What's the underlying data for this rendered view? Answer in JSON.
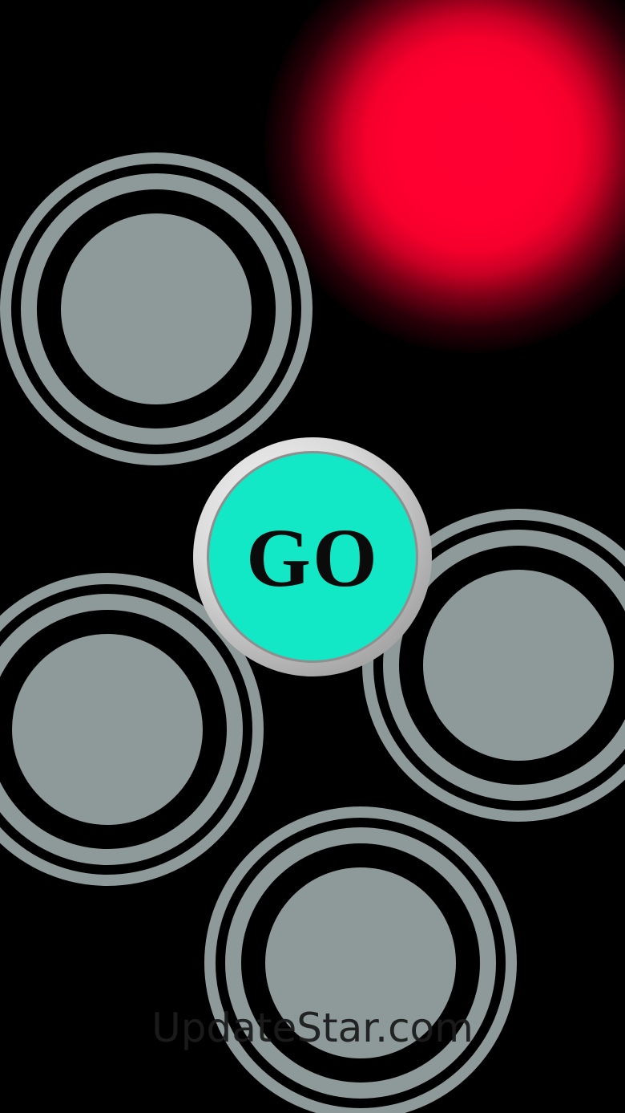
{
  "game": {
    "go_button_label": "GO",
    "pads": [
      "top-left",
      "middle-left",
      "middle-right",
      "bottom"
    ],
    "colors": {
      "background": "#000000",
      "pad": "#8d9a99",
      "go_face": "#13e8c6",
      "glow": "#ff0033"
    }
  },
  "watermark": {
    "text": "UpdateStar.com"
  }
}
